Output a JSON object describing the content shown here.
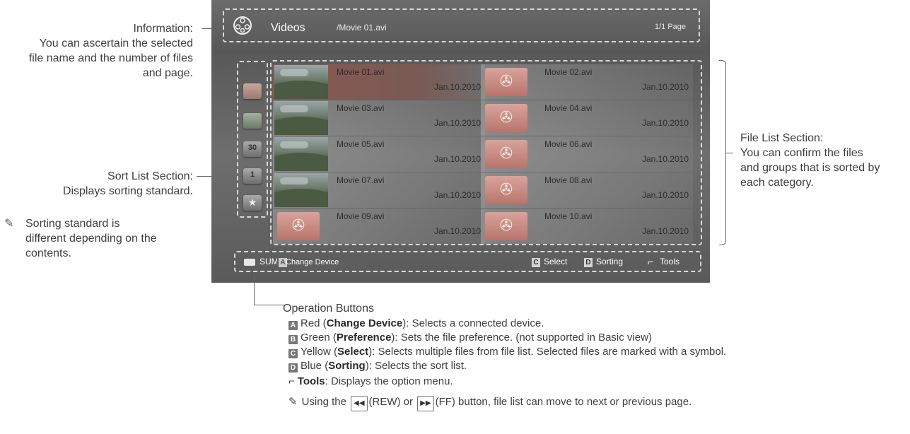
{
  "annotations": {
    "information": [
      "Information:",
      "You can ascertain the selected",
      "file name and the number of files",
      "and page."
    ],
    "sort_list": [
      "Sort List Section:",
      "Displays sorting standard."
    ],
    "sort_note": [
      "Sorting standard is",
      "different depending on the",
      "contents."
    ],
    "file_list": [
      "File List Section:",
      "You can confirm the files",
      "and groups that is sorted by",
      "each category."
    ]
  },
  "screen": {
    "header": {
      "title": "Videos",
      "file": "/Movie 01.avi",
      "page": "1/1 Page"
    },
    "sort_icons": [
      "folder-icon",
      "image-icon",
      "calendar-icon",
      "date-icon",
      "star-icon"
    ],
    "sort_icon_text": {
      "calendar": "30",
      "date": "1"
    },
    "files": [
      {
        "name": "Movie 01.avi",
        "date": "Jan.10.2010",
        "thumb": "photo",
        "selected": true
      },
      {
        "name": "Movie 02.avi",
        "date": "Jan.10.2010",
        "thumb": "reel"
      },
      {
        "name": "Movie 03.avi",
        "date": "Jan.10.2010",
        "thumb": "photo"
      },
      {
        "name": "Movie 04.avi",
        "date": "Jan.10.2010",
        "thumb": "reel"
      },
      {
        "name": "Movie 05.avi",
        "date": "Jan.10.2010",
        "thumb": "photo"
      },
      {
        "name": "Movie 06.avi",
        "date": "Jan.10.2010",
        "thumb": "reel"
      },
      {
        "name": "Movie 07.avi",
        "date": "Jan.10.2010",
        "thumb": "photo"
      },
      {
        "name": "Movie 08.avi",
        "date": "Jan.10.2010",
        "thumb": "reel"
      },
      {
        "name": "Movie 09.avi",
        "date": "Jan.10.2010",
        "thumb": "reel"
      },
      {
        "name": "Movie 10.avi",
        "date": "Jan.10.2010",
        "thumb": "reel"
      }
    ],
    "footer": {
      "sum": "SUM",
      "change_device_key": "A",
      "change_device": "Change Device",
      "select_key": "C",
      "select": "Select",
      "sorting_key": "D",
      "sorting": "Sorting",
      "tools": "Tools"
    }
  },
  "operation": {
    "title": "Operation Buttons",
    "items": [
      {
        "key": "A",
        "pre": "Red (",
        "bold": "Change Device",
        "post": "): Selects a connected device."
      },
      {
        "key": "B",
        "pre": "Green (",
        "bold": "Preference",
        "post": "): Sets the file preference. (not supported in Basic view)"
      },
      {
        "key": "C",
        "pre": "Yellow (",
        "bold": "Select",
        "post": "): Selects multiple files from file list. Selected files are marked with a symbol."
      },
      {
        "key": "D",
        "pre": "Blue (",
        "bold": "Sorting",
        "post": "): Selects the sort list."
      }
    ],
    "tools_bold": "Tools",
    "tools_text": ": Displays the option menu.",
    "note_pre": "Using the",
    "rew_btn": "◀◀",
    "rew_label": "(REW) or",
    "ff_btn": "▶▶",
    "note_post": "(FF) button, file list can move to next or previous page."
  },
  "colors": {
    "selected_tile": "#8a5750",
    "reel_thumb": "#b7756c",
    "screen_bg": "#626262"
  }
}
